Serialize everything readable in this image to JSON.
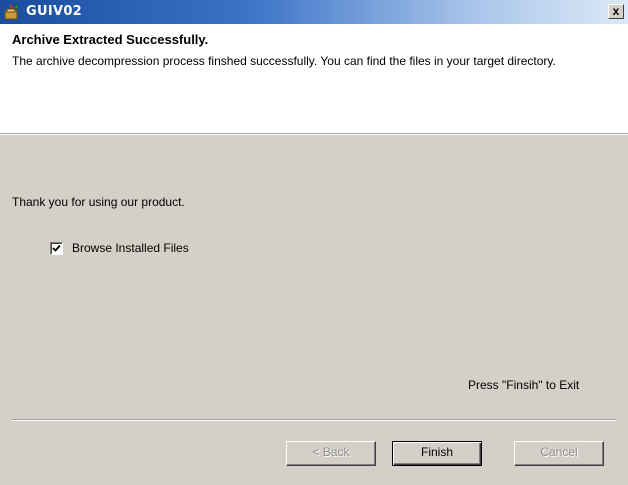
{
  "window": {
    "title": "GUIV02",
    "close_label": "x"
  },
  "header": {
    "title": "Archive Extracted Successfully.",
    "description": "The archive decompression process finshed successfully. You can find the files in your target directory."
  },
  "body": {
    "thank_you": "Thank you for using our product.",
    "browse_checkbox": {
      "label": "Browse Installed Files",
      "checked": true
    },
    "exit_hint": "Press \"Finsih\" to Exit"
  },
  "buttons": {
    "back": "< Back",
    "finish": "Finish",
    "cancel": "Cancel"
  },
  "icons": {
    "app": "setup-app-icon",
    "check": "checkmark-icon"
  }
}
